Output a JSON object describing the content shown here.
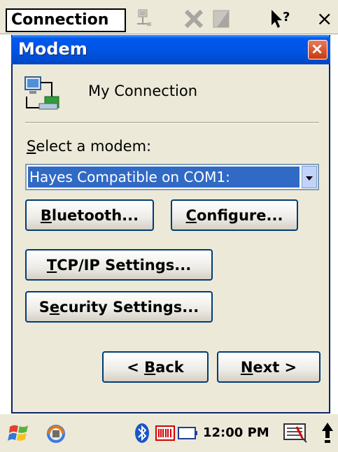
{
  "topbar": {
    "menu_title": "Connection",
    "help_glyph": "?",
    "close_glyph": "×"
  },
  "dialog": {
    "title": "Modem",
    "connection_name": "My Connection",
    "select_label_prefix": "S",
    "select_label_rest": "elect a modem:",
    "selected_modem": "Hayes Compatible on COM1:",
    "buttons": {
      "bluetooth": {
        "mnemonic": "B",
        "rest": "luetooth..."
      },
      "configure": {
        "mnemonic": "C",
        "rest": "onfigure..."
      },
      "tcpip": {
        "mnemonic": "T",
        "rest": "CP/IP Settings..."
      },
      "security_pre": "S",
      "security": {
        "mnemonic": "e",
        "rest": "curity Settings..."
      },
      "back": {
        "pre": "< ",
        "mnemonic": "B",
        "rest": "ack"
      },
      "next": {
        "mnemonic": "N",
        "rest": "ext >"
      }
    }
  },
  "taskbar": {
    "clock": "12:00 PM"
  },
  "icons": [
    "start-icon",
    "sync-icon",
    "bluetooth-icon",
    "scanner-icon",
    "battery-icon",
    "keyboard-icon",
    "up-arrow-icon",
    "network-icon",
    "delete-icon",
    "properties-icon",
    "help-icon",
    "close-icon",
    "connection-icon"
  ],
  "colors": {
    "titlebar": "#0054e3",
    "selection": "#316ac5",
    "button_border": "#003c74",
    "dialog_bg": "#ece9d8"
  }
}
